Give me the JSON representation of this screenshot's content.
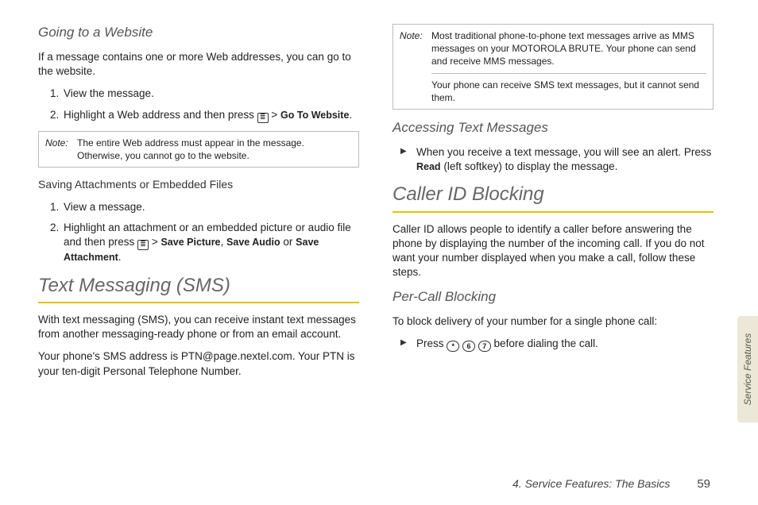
{
  "left": {
    "h_website": "Going to a Website",
    "p_website": "If a message contains one or more Web addresses, you can go to the website.",
    "steps_website": {
      "s1": "View the message.",
      "s2a": "Highlight a Web address and then press ",
      "s2b": " > ",
      "s2c": "Go To Website",
      "s2d": "."
    },
    "note1": {
      "label": "Note:",
      "text": "The entire Web address must appear in the message. Otherwise, you cannot go to the website."
    },
    "h_save": "Saving Attachments or Embedded Files",
    "steps_save": {
      "s1": "View a message.",
      "s2a": "Highlight an attachment or an embedded picture or audio file and then press ",
      "s2b": " > ",
      "s2c": "Save Picture",
      "s2d": ", ",
      "s2e": "Save Audio",
      "s2f": " or ",
      "s2g": "Save Attachment",
      "s2h": "."
    },
    "h_sms": "Text Messaging (SMS)",
    "p_sms1": "With text messaging (SMS), you can receive instant text messages from another messaging-ready phone or from an email account.",
    "p_sms2": "Your phone's SMS address is PTN@page.nextel.com. Your PTN is your ten-digit Personal Telephone Number."
  },
  "right": {
    "note2": {
      "label": "Note:",
      "t1": "Most traditional phone-to-phone text messages arrive as MMS messages on your MOTOROLA BRUTE. Your phone can send and receive MMS messages.",
      "t2": "Your phone can receive SMS text messages, but it cannot send them."
    },
    "h_access": "Accessing Text Messages",
    "bullet_access_a": "When you receive a text message, you will see an alert. Press ",
    "bullet_access_b": "Read",
    "bullet_access_c": " (left softkey) to display the message.",
    "h_cid": "Caller ID Blocking",
    "p_cid": "Caller ID allows people to identify a caller before answering the phone by displaying the number of the incoming call. If you do not want your number displayed when you make a call, follow these steps.",
    "h_percall": "Per-Call Blocking",
    "p_percall": "To block delivery of your number for a single phone call:",
    "bullet_percall_a": "Press ",
    "key_star": "*",
    "key_6": "6",
    "key_7": "7",
    "bullet_percall_b": " before dialing the call."
  },
  "sidetab": "Service Features",
  "footer": {
    "chapter": "4. Service Features: The Basics",
    "page": "59"
  }
}
